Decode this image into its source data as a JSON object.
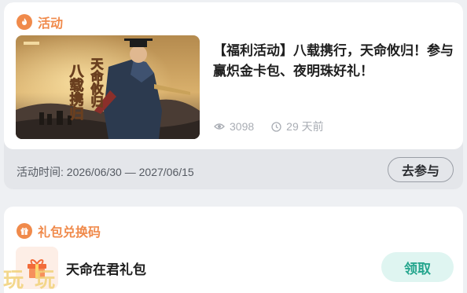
{
  "activity": {
    "section_title": "活动",
    "headline": "【福利活动】八载携行，天命攸归！参与赢炽金卡包、夜明珠好礼！",
    "views": "3098",
    "age": "29 天前",
    "time_range": "活动时间: 2026/06/30 — 2027/06/15",
    "join_label": "去参与",
    "banner_text": [
      "八载携归",
      "天命攸归"
    ]
  },
  "giftcode": {
    "section_title": "礼包兑换码",
    "item_name": "天命在君礼包",
    "claim_label": "领取"
  },
  "watermark": "玩玩",
  "colors": {
    "accent_orange": "#f08a4b",
    "claim_teal": "#26a68e",
    "claim_bg": "#dff5f1"
  },
  "icons": [
    "flame-icon",
    "eye-icon",
    "clock-icon",
    "gift-icon"
  ]
}
